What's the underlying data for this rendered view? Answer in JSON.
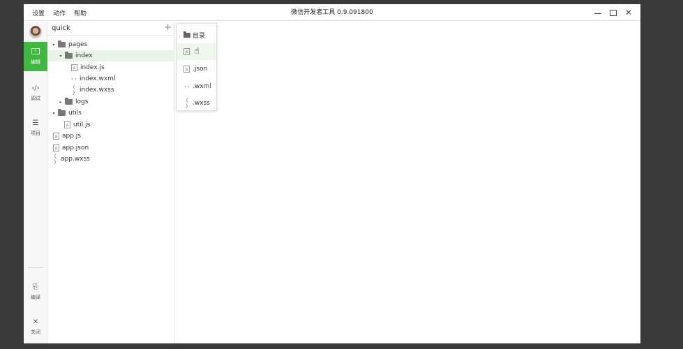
{
  "titlebar": {
    "menu": [
      "设置",
      "动作",
      "帮助"
    ],
    "title": "微信开发者工具 0.9.091800"
  },
  "sidebar": {
    "items": [
      {
        "label": "编辑",
        "icon": "edit-icon",
        "active": true
      },
      {
        "label": "调试",
        "icon": "code-icon",
        "active": false
      },
      {
        "label": "项目",
        "icon": "list-icon",
        "active": false
      }
    ],
    "bottom_items": [
      {
        "label": "编译",
        "icon": "compile-icon"
      },
      {
        "label": "关闭",
        "icon": "close-icon"
      }
    ],
    "active_color": "#3fb83f"
  },
  "tree": {
    "project_name": "quick",
    "add_symbol": "+",
    "rows": [
      {
        "label": "pages",
        "type": "folder",
        "expanded": true
      },
      {
        "label": "index",
        "type": "folder",
        "expanded": true
      },
      {
        "label": "index.js",
        "type": "js"
      },
      {
        "label": "index.wxml",
        "type": "wxml"
      },
      {
        "label": "index.wxss",
        "type": "wxss"
      },
      {
        "label": "logs",
        "type": "folder",
        "expanded": false
      },
      {
        "label": "utils",
        "type": "folder",
        "expanded": true
      },
      {
        "label": "util.js",
        "type": "js"
      },
      {
        "label": "app.js",
        "type": "js"
      },
      {
        "label": "app.json",
        "type": "js"
      },
      {
        "label": "app.wxss",
        "type": "wxss"
      }
    ]
  },
  "popup": {
    "items": [
      "目录",
      "",
      ".json",
      ".wxml",
      ".wxss"
    ]
  },
  "icons": {
    "js": "JS",
    "wxml": "‹ ›",
    "wxss": "{ }",
    "expanded": "▾",
    "collapsed": "▸"
  }
}
